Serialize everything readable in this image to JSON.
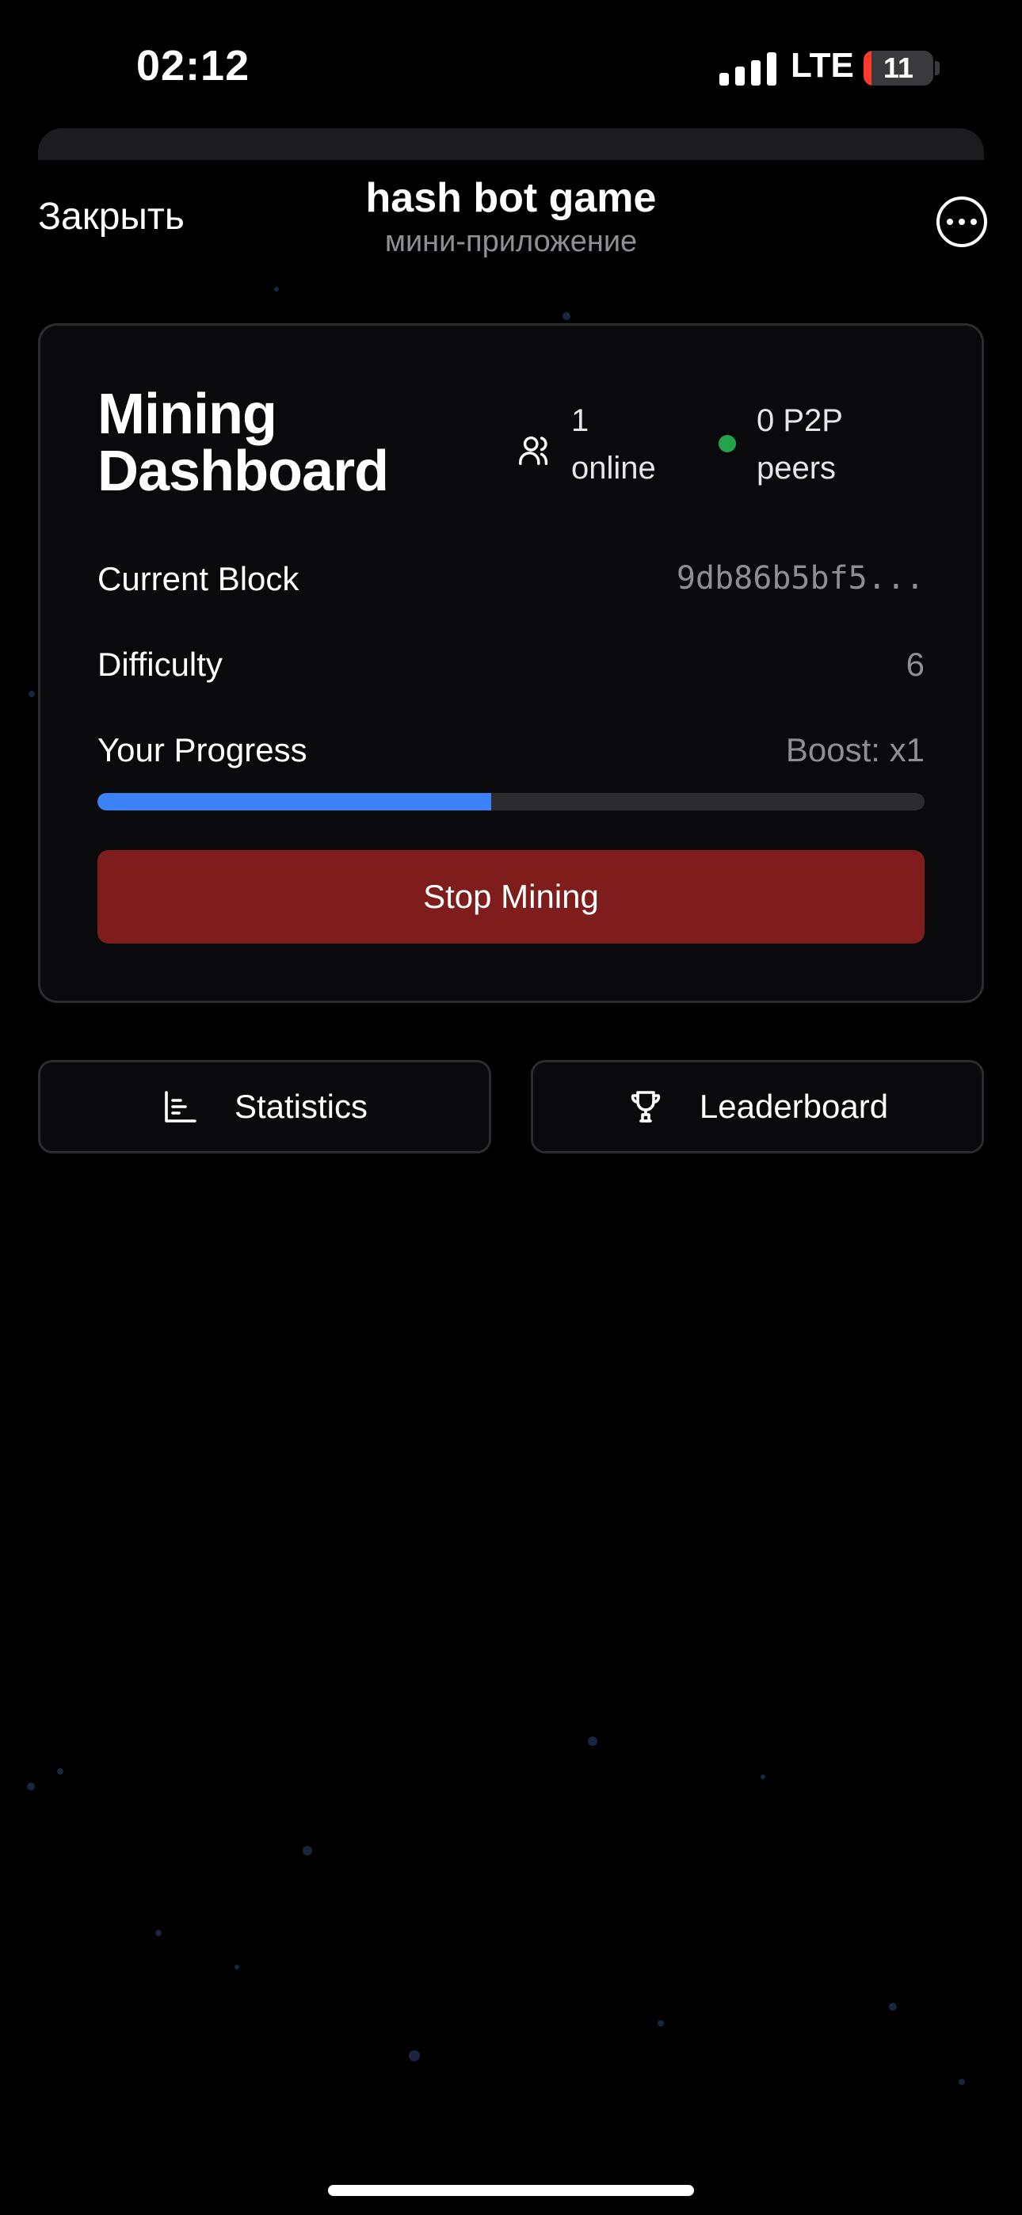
{
  "status_bar": {
    "time": "02:12",
    "network": "LTE",
    "battery_level": "11",
    "battery_fraction": 0.11
  },
  "header": {
    "close_label": "Закрыть",
    "title": "hash bot game",
    "subtitle": "мини-приложение",
    "more_icon": "ellipsis-circle-icon"
  },
  "dashboard": {
    "title": "Mining Dashboard",
    "online_count": "1",
    "online_label": "online",
    "online_icon": "users-icon",
    "peers_text": "0 P2P",
    "peers_label": "peers",
    "peers_status_color": "#22a34a",
    "current_block_label": "Current Block",
    "current_block_value": "9db86b5bf5...",
    "difficulty_label": "Difficulty",
    "difficulty_value": "6",
    "progress_label": "Your Progress",
    "boost_text": "Boost: x1",
    "progress_fraction": 0.476,
    "progress_color": "#3b82f6",
    "stop_button_label": "Stop Mining",
    "stop_button_color": "#7f1d1d"
  },
  "actions": {
    "statistics_label": "Statistics",
    "statistics_icon": "bar-chart-icon",
    "leaderboard_label": "Leaderboard",
    "leaderboard_icon": "trophy-icon"
  }
}
